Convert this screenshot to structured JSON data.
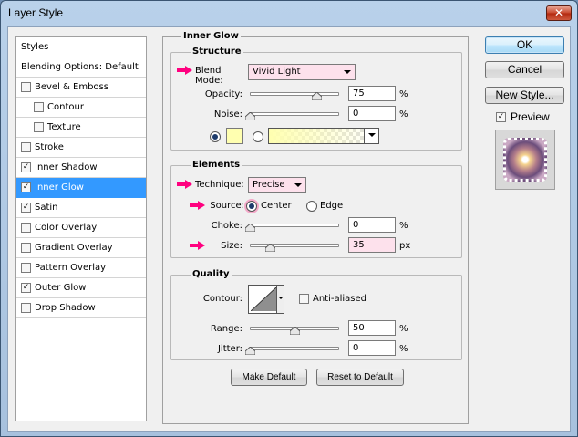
{
  "window": {
    "title": "Layer Style",
    "close_glyph": "✕"
  },
  "sidebar": {
    "header": "Styles",
    "blending": "Blending Options: Default",
    "items": [
      {
        "label": "Bevel & Emboss",
        "checked": false
      },
      {
        "label": "Contour",
        "checked": false
      },
      {
        "label": "Texture",
        "checked": false
      },
      {
        "label": "Stroke",
        "checked": false
      },
      {
        "label": "Inner Shadow",
        "checked": true
      },
      {
        "label": "Inner Glow",
        "checked": true
      },
      {
        "label": "Satin",
        "checked": true
      },
      {
        "label": "Color Overlay",
        "checked": false
      },
      {
        "label": "Gradient Overlay",
        "checked": false
      },
      {
        "label": "Pattern Overlay",
        "checked": false
      },
      {
        "label": "Outer Glow",
        "checked": true
      },
      {
        "label": "Drop Shadow",
        "checked": false
      }
    ],
    "selected": "Inner Glow"
  },
  "panel": {
    "title": "Inner Glow",
    "structure": {
      "title": "Structure",
      "blend_mode_label": "Blend Mode:",
      "blend_mode_value": "Vivid Light",
      "opacity_label": "Opacity:",
      "opacity_value": "75",
      "noise_label": "Noise:",
      "noise_value": "0",
      "percent": "%",
      "swatch_color": "#ffffb0",
      "gradient_color": "#ffffb0"
    },
    "elements": {
      "title": "Elements",
      "technique_label": "Technique:",
      "technique_value": "Precise",
      "source_label": "Source:",
      "source_center": "Center",
      "source_edge": "Edge",
      "choke_label": "Choke:",
      "choke_value": "0",
      "size_label": "Size:",
      "size_value": "35",
      "percent": "%",
      "px": "px"
    },
    "quality": {
      "title": "Quality",
      "contour_label": "Contour:",
      "antialiased_label": "Anti-aliased",
      "range_label": "Range:",
      "range_value": "50",
      "jitter_label": "Jitter:",
      "jitter_value": "0",
      "percent": "%"
    },
    "make_default": "Make Default",
    "reset_default": "Reset to Default"
  },
  "buttons": {
    "ok": "OK",
    "cancel": "Cancel",
    "new_style": "New Style...",
    "preview_label": "Preview",
    "preview_checked": true
  },
  "colors": {
    "accent_arrow": "#ff007f",
    "selection": "#3399ff"
  }
}
